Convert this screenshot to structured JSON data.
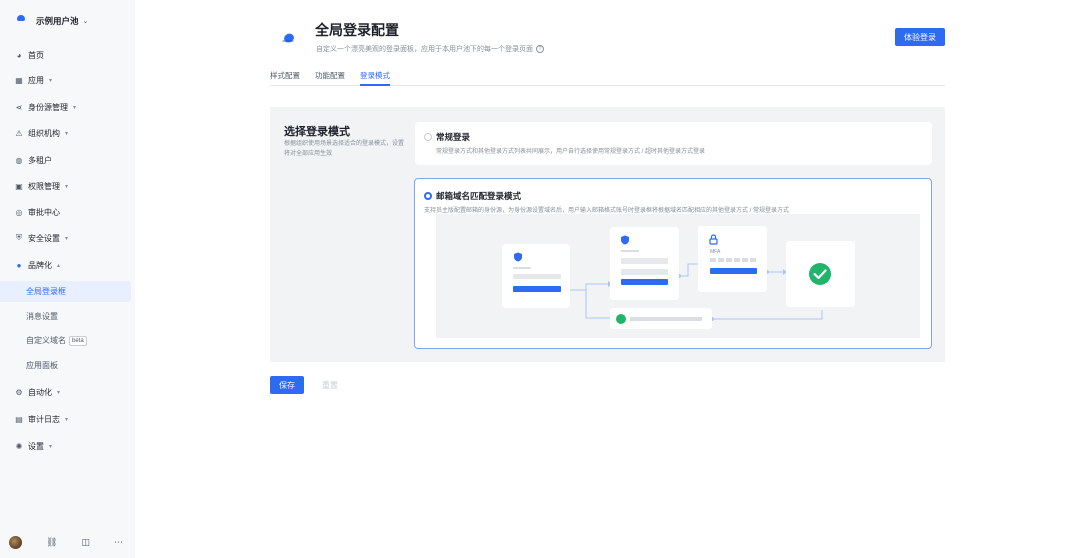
{
  "sidebar": {
    "pool_name": "示例用户池",
    "items": [
      {
        "label": "首页",
        "icon": "dashboard-icon"
      },
      {
        "label": "应用",
        "icon": "apps-icon"
      },
      {
        "label": "身份源管理",
        "icon": "identity-source-icon"
      },
      {
        "label": "组织机构",
        "icon": "organization-icon"
      },
      {
        "label": "多租户",
        "icon": "tenant-icon"
      },
      {
        "label": "权限管理",
        "icon": "permission-icon"
      },
      {
        "label": "审批中心",
        "icon": "approval-icon"
      },
      {
        "label": "安全设置",
        "icon": "security-icon"
      },
      {
        "label": "品牌化",
        "icon": "branding-icon"
      },
      {
        "label": "自动化",
        "icon": "automation-icon"
      },
      {
        "label": "审计日志",
        "icon": "audit-log-icon"
      },
      {
        "label": "设置",
        "icon": "settings-icon"
      }
    ],
    "branding_sub": [
      {
        "label": "全局登录框"
      },
      {
        "label": "消息设置"
      },
      {
        "label": "自定义域名",
        "badge": "beta"
      },
      {
        "label": "应用面板"
      }
    ]
  },
  "header": {
    "title": "全局登录配置",
    "description": "自定义一个漂亮美观的登录面板，应用于本用户池下的每一个登录页面",
    "try_button": "体验登录"
  },
  "tabs": [
    "样式配置",
    "功能配置",
    "登录模式"
  ],
  "active_tab": "登录模式",
  "section": {
    "title": "选择登录模式",
    "description": "根据组织使用场景选择适合的登录模式，设置将对全部应用生效"
  },
  "options": [
    {
      "title": "常规登录",
      "description": "常规登录方式和其他登录方式列表共同展示，用户自行选择使用常规登录方式 / 超时其他登录方式登录",
      "checked": false
    },
    {
      "title": "邮箱域名匹配登录模式",
      "description": "支持员主版配置邮箱的身份源，为身份源设置域名后，用户输入邮箱格式账号时登录框将根据域名匹配相应的其他登录方式 / 常规登录方式",
      "checked": true
    }
  ],
  "diagram": {
    "mfa_label": "MFA"
  },
  "actions": {
    "save": "保存",
    "reset": "重置"
  },
  "colors": {
    "primary": "#2e6bf3",
    "success": "#1fb56a"
  }
}
